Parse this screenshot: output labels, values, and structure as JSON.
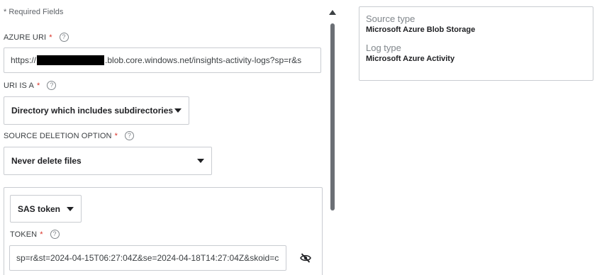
{
  "form": {
    "required_note": "* Required Fields",
    "azure_uri": {
      "label": "AZURE URI",
      "required_mark": "*",
      "value_prefix": "https://",
      "value_suffix": ".blob.core.windows.net/insights-activity-logs?sp=r&s"
    },
    "uri_is_a": {
      "label": "URI IS A",
      "required_mark": "*",
      "selected": "Directory which includes subdirectories"
    },
    "source_deletion": {
      "label": "SOURCE DELETION OPTION",
      "required_mark": "*",
      "selected": "Never delete files"
    },
    "auth": {
      "method_selected": "SAS token",
      "token": {
        "label": "TOKEN",
        "required_mark": "*",
        "value": "sp=r&st=2024-04-15T06:27:04Z&se=2024-04-18T14:27:04Z&skoid=c"
      }
    },
    "help_glyph": "?"
  },
  "summary": {
    "source_type_label": "Source type",
    "source_type_value": "Microsoft Azure Blob Storage",
    "log_type_label": "Log type",
    "log_type_value": "Microsoft Azure Activity"
  },
  "colors": {
    "required": "#d93025",
    "border": "#c9ccd1",
    "scrollbar": "#6b6f75"
  },
  "icons": {
    "help": "help-circle-icon",
    "dropdown": "caret-down-icon",
    "visibility_toggle": "eye-off-icon",
    "scroll_up": "scroll-up-arrow-icon"
  }
}
